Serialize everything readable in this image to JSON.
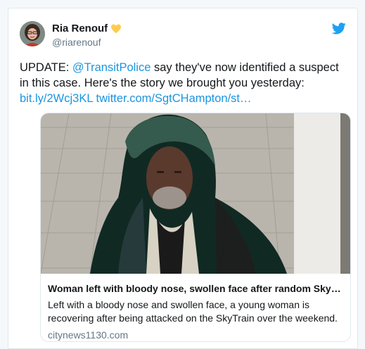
{
  "author": {
    "display_name": "Ria Renouf",
    "handle": "@riarenouf"
  },
  "icons": {
    "badge": "yellow-heart-icon",
    "platform": "twitter-bird-icon",
    "brand_color": "#1da1f2",
    "heart_color": "#ffcc4d",
    "link_color": "#1b95e0"
  },
  "tweet": {
    "prefix": "UPDATE: ",
    "mention": "@TransitPolice",
    "body": " say they've now identified a suspect in this case. Here's the story we brought you yesterday: ",
    "link1": "bit.ly/2Wcj3KL",
    "link2": "twitter.com/SgtCHampton/st…"
  },
  "card": {
    "title": "Woman left with bloody nose, swollen face after random SkyT...",
    "description": "Left with a bloody nose and swollen face, a young woman is recovering after being attacked on the SkyTrain over the weekend.",
    "domain": "citynews1130.com"
  }
}
